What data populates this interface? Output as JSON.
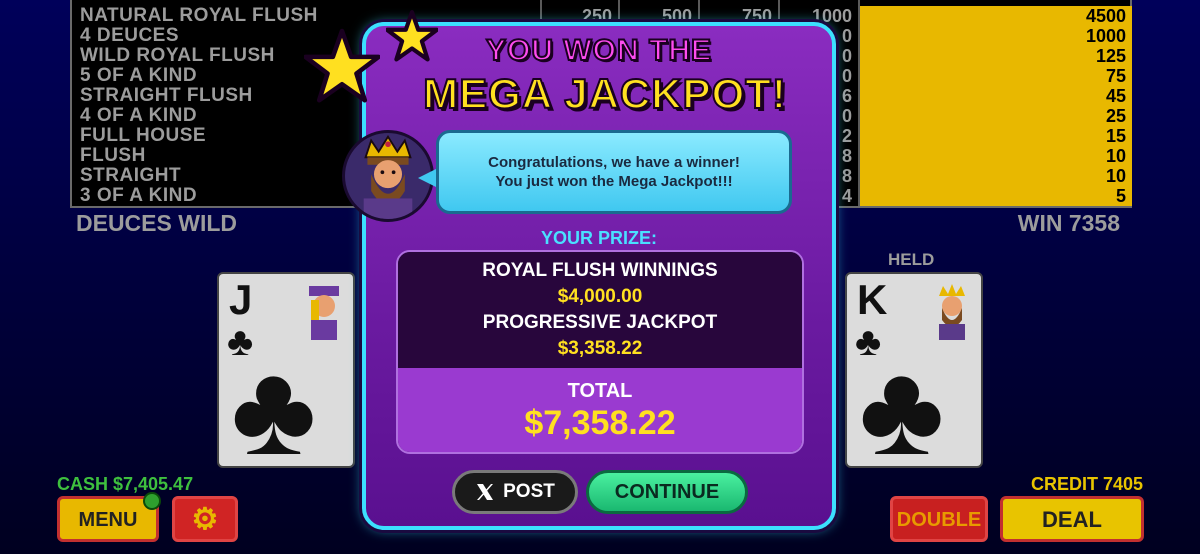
{
  "paytable": {
    "header_cols": [
      "250",
      "500",
      "750",
      "1000"
    ],
    "rows": [
      {
        "name": "NATURAL ROYAL FLUSH",
        "max": "4500"
      },
      {
        "name": "4 DEUCES",
        "max": "1000"
      },
      {
        "name": "WILD ROYAL FLUSH",
        "max": "125"
      },
      {
        "name": "5 OF A KIND",
        "max": "75"
      },
      {
        "name": "STRAIGHT FLUSH",
        "max": "45"
      },
      {
        "name": "4 OF A KIND",
        "max": "25"
      },
      {
        "name": "FULL HOUSE",
        "max": "15"
      },
      {
        "name": "FLUSH",
        "max": "10"
      },
      {
        "name": "STRAIGHT",
        "max": "10"
      },
      {
        "name": "3 OF A KIND",
        "max": "5"
      }
    ],
    "visible_partial": [
      "0",
      "0",
      "0",
      "6",
      "0",
      "2",
      "8",
      "8",
      "4"
    ],
    "highlight_color": "#e8b800"
  },
  "game": {
    "title": "DEUCES WILD",
    "win": "WIN 7358",
    "held": "HELD"
  },
  "cards": [
    {
      "rank": "J",
      "suit": "♣",
      "face": "jack-icon"
    },
    {
      "rank": "K",
      "suit": "♣",
      "face": "king-icon"
    }
  ],
  "footer": {
    "cash": "CASH $7,405.47",
    "credit": "CREDIT 7405",
    "menu": "MENU",
    "gear": "⚙",
    "double": "DOUBLE",
    "deal": "DEAL"
  },
  "modal": {
    "headline1": "YOU WON THE",
    "headline2": "MEGA JACKPOT!",
    "message_line1": "Congratulations, we have a winner!",
    "message_line2": "You just won the Mega Jackpot!!!",
    "prize_label": "YOUR PRIZE:",
    "royal_label": "ROYAL FLUSH WINNINGS",
    "royal_value": "$4,000.00",
    "progressive_label": "PROGRESSIVE JACKPOT",
    "progressive_value": "$3,358.22",
    "total_label": "TOTAL",
    "total_value": "$7,358.22",
    "post_button": "POST",
    "post_icon": "x-logo-icon",
    "continue_button": "CONTINUE"
  },
  "colors": {
    "modal_border": "#3ce0ff",
    "headline_pink": "#ff4cf0",
    "headline_yellow": "#ffe020",
    "continue_green": "#1ab870"
  }
}
